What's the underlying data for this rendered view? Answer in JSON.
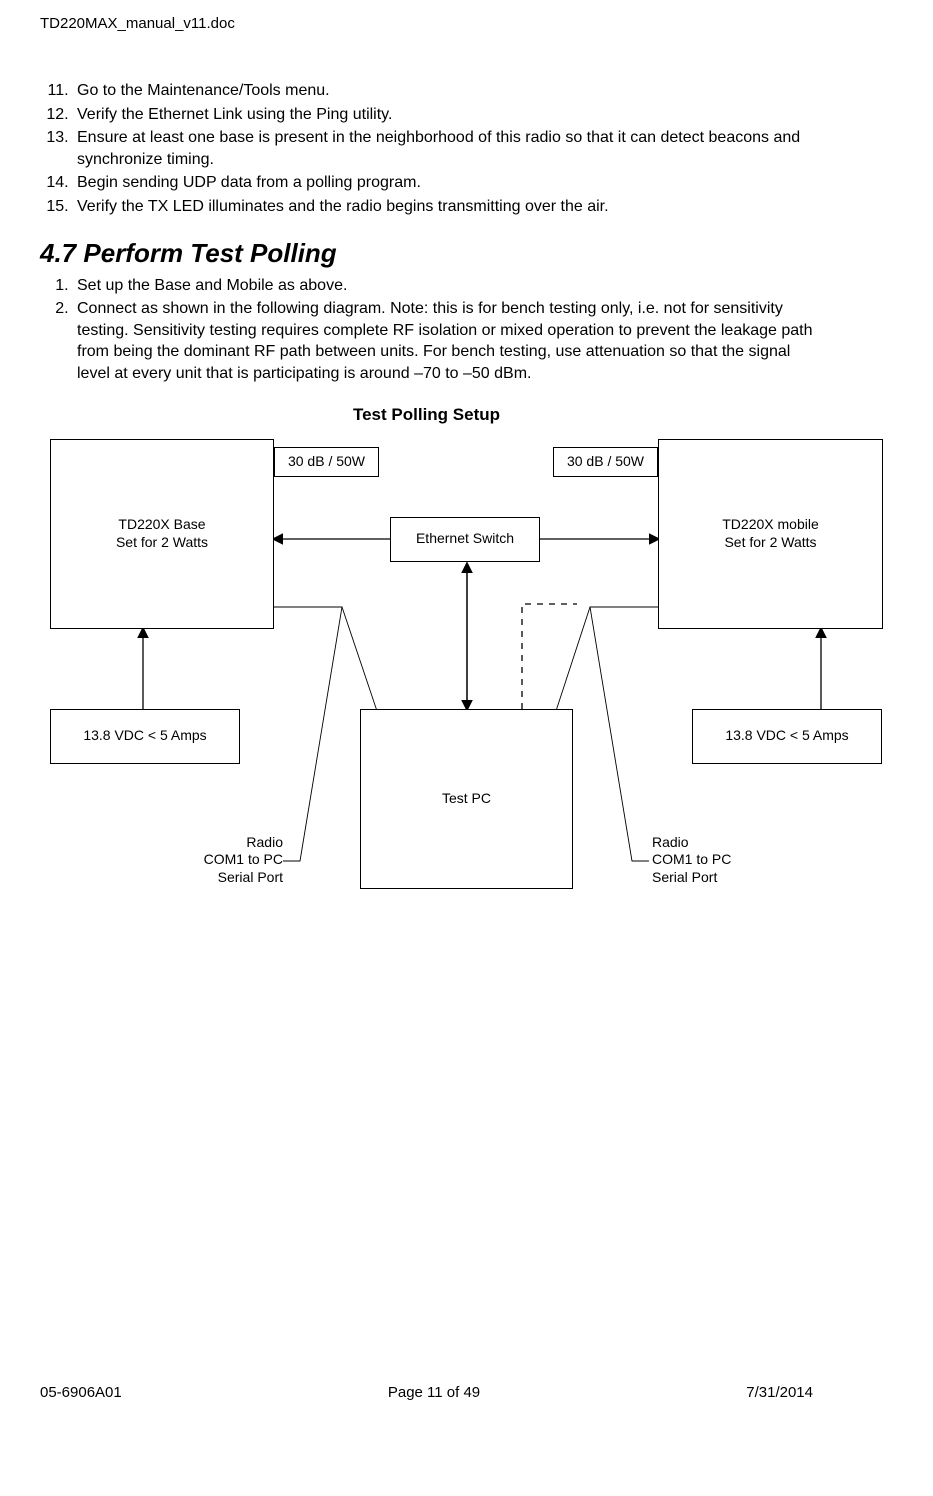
{
  "doc_header": "TD220MAX_manual_v11.doc",
  "steps1": {
    "s11": "Go to the Maintenance/Tools menu.",
    "s12": "Verify the Ethernet Link using the Ping utility.",
    "s13": "Ensure at least one base is present in the neighborhood of this radio so that it can detect beacons and synchronize timing.",
    "s14": "Begin sending UDP data from a polling program.",
    "s15": "Verify the TX LED illuminates and the radio begins transmitting over the air."
  },
  "section": {
    "number": "4.7",
    "title": "Perform Test Polling"
  },
  "steps2": {
    "s1": "Set up the Base and Mobile as above.",
    "s2": "Connect as shown in the following diagram.  Note: this is for bench testing only, i.e. not for sensitivity testing.  Sensitivity testing requires complete RF isolation or mixed operation to prevent the leakage path from being the dominant RF path between units.  For bench testing, use attenuation so that the signal level at every unit that is participating is around –70 to –50 dBm."
  },
  "diagram": {
    "title": "Test Polling Setup",
    "base_box": "TD220X Base\nSet for 2 Watts",
    "mobile_box": "TD220X mobile\nSet for 2 Watts",
    "att_left": "30 dB / 50W",
    "att_right": "30 dB / 50W",
    "eth_switch": "Ethernet Switch",
    "psu_left": "13.8 VDC < 5 Amps",
    "psu_right": "13.8 VDC < 5 Amps",
    "test_pc": "Test PC",
    "serial_left": "Radio\nCOM1 to PC\nSerial Port",
    "serial_right": "Radio\nCOM1 to PC\nSerial Port"
  },
  "footer": {
    "left": "05-6906A01",
    "center": "Page 11 of 49",
    "right": "7/31/2014"
  }
}
